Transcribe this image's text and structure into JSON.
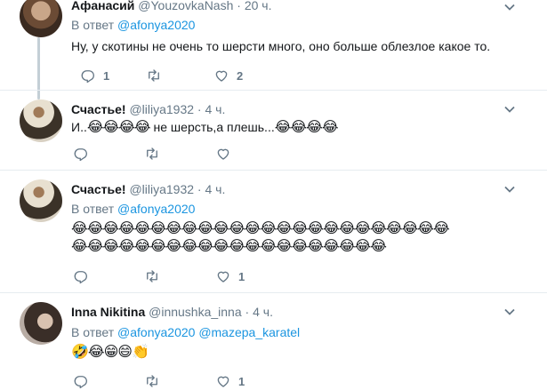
{
  "tweets": [
    {
      "name": "Афанасий",
      "handle": "@YouzovkaNash",
      "time": "20 ч.",
      "reply_prefix": "В ответ",
      "mentions": [
        "@afonya2020"
      ],
      "text": "Ну, у скотины не очень то шерсти много, оно больше облезлое какое то.",
      "reply_count": "1",
      "retweet_count": "",
      "like_count": "2"
    },
    {
      "name": "Счастье!",
      "handle": "@liliya1932",
      "time": "4 ч.",
      "text_lead": "И..",
      "emoji_a": "😂😂😂😂",
      "text_mid": " не шерсть,а плешь...",
      "emoji_b": "😂😂😂😂",
      "reply_count": "",
      "retweet_count": "",
      "like_count": ""
    },
    {
      "name": "Счастье!",
      "handle": "@liliya1932",
      "time": "4 ч.",
      "reply_prefix": "В ответ",
      "mentions": [
        "@afonya2020"
      ],
      "emoji_line1": "😂😂😂😂😂😂😂😂😂😂😂😂😂😂😂😂😂😂😂😂😂😂😂😂",
      "emoji_line2": "😂😂😂😂😂😂😂😂😂😂😂😂😂😂😂😂😂😂😂😂",
      "reply_count": "",
      "retweet_count": "",
      "like_count": "1"
    },
    {
      "name": "Inna Nikitina",
      "handle": "@innushka_inna",
      "time": "4 ч.",
      "reply_prefix": "В ответ",
      "mentions": [
        "@afonya2020",
        "@mazepa_karatel"
      ],
      "emojis": "🤣😂😁😄👏",
      "reply_count": "",
      "retweet_count": "",
      "like_count": "1"
    }
  ],
  "separator": " · ",
  "colors": {
    "accent": "#1b95e0",
    "muted": "#657786",
    "border": "#e6ecf0"
  },
  "icons": [
    "reply-icon",
    "retweet-icon",
    "like-icon",
    "chevron-down-icon"
  ]
}
